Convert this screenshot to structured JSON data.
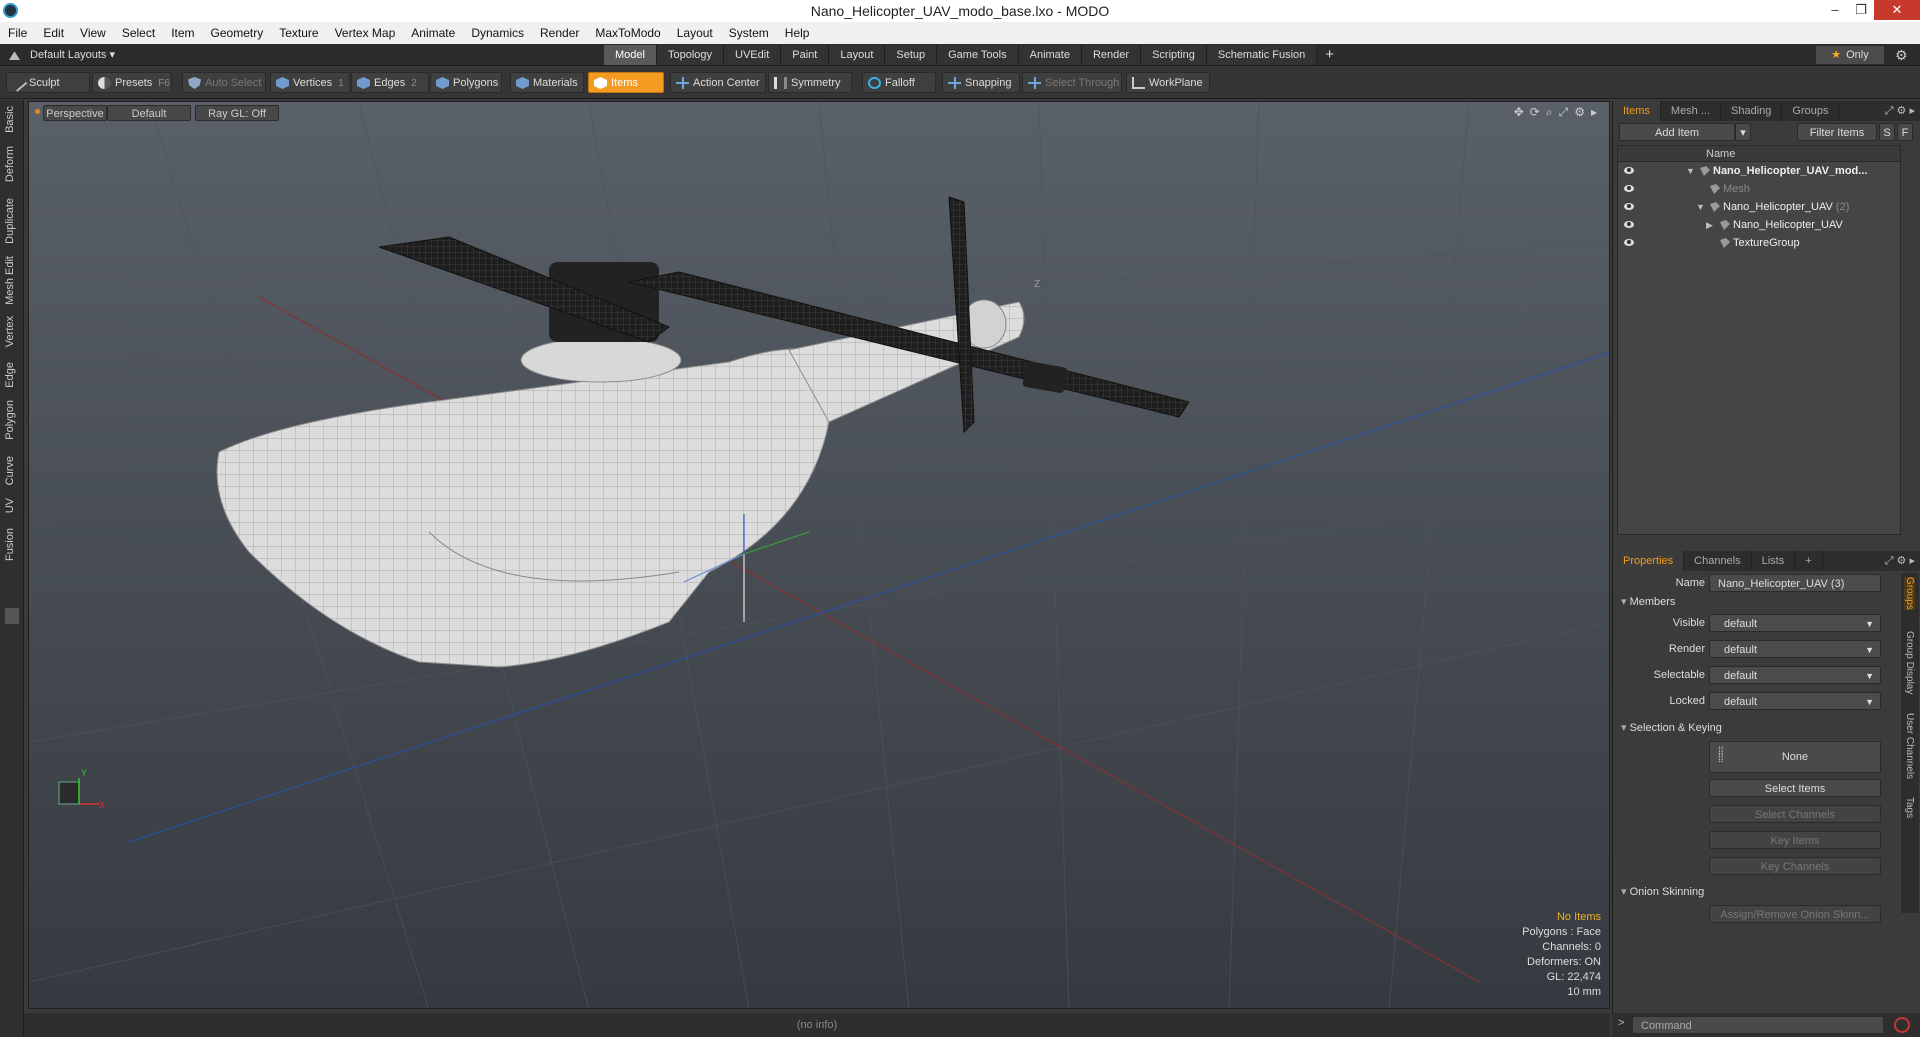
{
  "window": {
    "title": "Nano_Helicopter_UAV_modo_base.lxo - MODO",
    "min_glyph": "–",
    "restore_glyph": "❐",
    "close_glyph": "✕"
  },
  "menu": [
    "File",
    "Edit",
    "View",
    "Select",
    "Item",
    "Geometry",
    "Texture",
    "Vertex Map",
    "Animate",
    "Dynamics",
    "Render",
    "MaxToModo",
    "Layout",
    "System",
    "Help"
  ],
  "layout_bar": {
    "layouts_label": "Default Layouts ▾",
    "tabs": [
      "Model",
      "Topology",
      "UVEdit",
      "Paint",
      "Layout",
      "Setup",
      "Game Tools",
      "Animate",
      "Render",
      "Scripting",
      "Schematic Fusion"
    ],
    "active_tab": "Model",
    "plus": "+",
    "only_label": "Only",
    "star": "★"
  },
  "toolbar": {
    "sculpt": "Sculpt",
    "presets": "Presets",
    "presets_key": "F6",
    "auto_select": "Auto Select",
    "vertices": "Vertices",
    "vertices_key": "1",
    "edges": "Edges",
    "edges_key": "2",
    "polygons": "Polygons",
    "materials": "Materials",
    "items": "Items",
    "action_center": "Action Center",
    "symmetry": "Symmetry",
    "falloff": "Falloff",
    "snapping": "Snapping",
    "select_through": "Select Through",
    "workplane": "WorkPlane"
  },
  "left_tabs": [
    "Basic",
    "Deform",
    "Duplicate",
    "Mesh Edit",
    "Vertex",
    "Edge",
    "Polygon",
    "Curve",
    "UV",
    "Fusion"
  ],
  "viewport": {
    "view_mode": "Perspective",
    "shading": "Default",
    "raygl": "Ray GL: Off",
    "axis_z": "Z",
    "gizmo_x": "X",
    "gizmo_y": "Y",
    "tool_icons": [
      "✥",
      "⟳",
      "⌕",
      "⤢",
      "⚙",
      "▸"
    ],
    "stats": {
      "no_items": "No Items",
      "polygons": "Polygons : Face",
      "channels": "Channels: 0",
      "deformers": "Deformers: ON",
      "gl": "GL: 22,474",
      "scale": "10 mm"
    }
  },
  "statusbar": {
    "info": "(no info)"
  },
  "items_panel": {
    "tabs": [
      "Items",
      "Mesh ...",
      "Shading",
      "Groups"
    ],
    "active_tab": "Items",
    "add_item": "Add Item",
    "filter_items": "Filter Items",
    "s_btn": "S",
    "f_btn": "F",
    "col_name": "Name",
    "rows": [
      {
        "label": "Nano_Helicopter_UAV_mod...",
        "indent": 0,
        "bold": true,
        "arrow": "▼",
        "sub": ""
      },
      {
        "label": "Mesh",
        "indent": 1,
        "bold": false,
        "arrow": "",
        "sub": "",
        "dim": true
      },
      {
        "label": "Nano_Helicopter_UAV",
        "indent": 1,
        "bold": false,
        "arrow": "▼",
        "sub": "(2)"
      },
      {
        "label": "Nano_Helicopter_UAV",
        "indent": 2,
        "bold": false,
        "arrow": "▶",
        "sub": ""
      },
      {
        "label": "TextureGroup",
        "indent": 2,
        "bold": false,
        "arrow": "",
        "sub": ""
      }
    ]
  },
  "props_panel": {
    "tabs": [
      "Properties",
      "Channels",
      "Lists"
    ],
    "active_tab": "Properties",
    "plus": "+",
    "name_label": "Name",
    "name_value": "Nano_Helicopter_UAV (3)",
    "members_section": "Members",
    "fields": [
      {
        "label": "Visible",
        "value": "default"
      },
      {
        "label": "Render",
        "value": "default"
      },
      {
        "label": "Selectable",
        "value": "default"
      },
      {
        "label": "Locked",
        "value": "default"
      }
    ],
    "selection_section": "Selection & Keying",
    "none_label": "None",
    "select_items": "Select Items",
    "select_channels": "Select Channels",
    "key_items": "Key Items",
    "key_channels": "Key Channels",
    "onion_section": "Onion Skinning",
    "assign_onion": "Assign/Remove Onion Skinn...",
    "side_tabs": [
      "Groups",
      "Group Display",
      "User Channels",
      "Tags"
    ]
  },
  "command": {
    "placeholder": "Command",
    "caret": ">"
  },
  "colors": {
    "accent": "#f39c1f",
    "viewport_top": "#5a6068",
    "viewport_bottom": "#353a40"
  }
}
